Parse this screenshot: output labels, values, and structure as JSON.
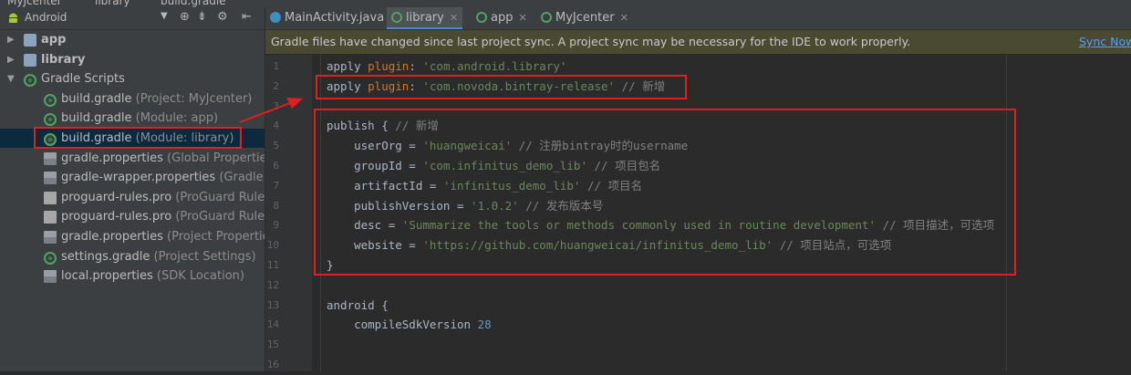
{
  "topbar": {
    "crumbs": [
      "MyJcenter",
      "library",
      "build.gradle"
    ]
  },
  "project_panel": {
    "view_label": "Android",
    "tree": [
      {
        "label": "app",
        "sub": "",
        "kind": "module",
        "arrow": "▶"
      },
      {
        "label": "library",
        "sub": "",
        "kind": "module",
        "arrow": "▶"
      },
      {
        "label": "Gradle Scripts",
        "sub": "",
        "kind": "gradle",
        "arrow": "▼"
      },
      {
        "label": "build.gradle",
        "sub": "(Project: MyJcenter)",
        "kind": "gradle"
      },
      {
        "label": "build.gradle",
        "sub": "(Module: app)",
        "kind": "gradle"
      },
      {
        "label": "build.gradle",
        "sub": "(Module: library)",
        "kind": "gradle",
        "selected": true
      },
      {
        "label": "gradle.properties",
        "sub": "(Global Properties)",
        "kind": "prop"
      },
      {
        "label": "gradle-wrapper.properties",
        "sub": "(Gradle Ve",
        "kind": "prop"
      },
      {
        "label": "proguard-rules.pro",
        "sub": "(ProGuard Rules fo",
        "kind": "pro"
      },
      {
        "label": "proguard-rules.pro",
        "sub": "(ProGuard Rules fo",
        "kind": "pro"
      },
      {
        "label": "gradle.properties",
        "sub": "(Project Properties)",
        "kind": "prop"
      },
      {
        "label": "settings.gradle",
        "sub": "(Project Settings)",
        "kind": "gradle"
      },
      {
        "label": "local.properties",
        "sub": "(SDK Location)",
        "kind": "prop"
      }
    ]
  },
  "tabs": [
    {
      "label": "MainActivity.java",
      "icon": "class-icon",
      "active": false
    },
    {
      "label": "library",
      "icon": "gradle-icon",
      "active": true
    },
    {
      "label": "app",
      "icon": "gradle-icon",
      "active": false
    },
    {
      "label": "MyJcenter",
      "icon": "gradle-icon",
      "active": false
    }
  ],
  "notification": {
    "message": "Gradle files have changed since last project sync. A project sync may be necessary for the IDE to work properly.",
    "action": "Sync Now"
  },
  "editor": {
    "lines": [
      {
        "n": "1",
        "parts": [
          [
            "plain",
            "apply "
          ],
          [
            "kw",
            "plugin"
          ],
          [
            "plain",
            ": "
          ],
          [
            "str",
            "'com.android.library'"
          ]
        ]
      },
      {
        "n": "2",
        "parts": [
          [
            "plain",
            "apply "
          ],
          [
            "kw",
            "plugin"
          ],
          [
            "plain",
            ": "
          ],
          [
            "str",
            "'com.novoda.bintray-release'"
          ],
          [
            "cm",
            " // 新增"
          ]
        ]
      },
      {
        "n": "3",
        "parts": []
      },
      {
        "n": "4",
        "parts": [
          [
            "plain",
            "publish { "
          ],
          [
            "cm",
            "// 新增"
          ]
        ],
        "fold": true
      },
      {
        "n": "5",
        "parts": [
          [
            "plain",
            "    userOrg = "
          ],
          [
            "str",
            "'huangweicai'"
          ],
          [
            "cm",
            " // 注册bintray时的username"
          ]
        ]
      },
      {
        "n": "6",
        "parts": [
          [
            "plain",
            "    groupId = "
          ],
          [
            "str",
            "'com.infinitus_demo_lib'"
          ],
          [
            "cm",
            " // 项目包名"
          ]
        ]
      },
      {
        "n": "7",
        "parts": [
          [
            "plain",
            "    artifactId = "
          ],
          [
            "str",
            "'infinitus_demo_lib'"
          ],
          [
            "cm",
            " // 项目名"
          ]
        ]
      },
      {
        "n": "8",
        "parts": [
          [
            "plain",
            "    publishVersion = "
          ],
          [
            "str",
            "'1.0.2'"
          ],
          [
            "cm",
            " // 发布版本号"
          ]
        ]
      },
      {
        "n": "9",
        "parts": [
          [
            "plain",
            "    desc = "
          ],
          [
            "str",
            "'Summarize the tools or methods commonly used in routine development'"
          ],
          [
            "cm",
            " // 项目描述，可选项"
          ]
        ]
      },
      {
        "n": "10",
        "parts": [
          [
            "plain",
            "    website = "
          ],
          [
            "str",
            "'https://github.com/huangweicai/infinitus_demo_lib'"
          ],
          [
            "cm",
            " // 项目站点，可选项"
          ]
        ]
      },
      {
        "n": "11",
        "parts": [
          [
            "plain",
            "}"
          ]
        ],
        "fold": true
      },
      {
        "n": "12",
        "parts": []
      },
      {
        "n": "13",
        "parts": [
          [
            "plain",
            "android {"
          ]
        ],
        "fold": true
      },
      {
        "n": "14",
        "parts": [
          [
            "plain",
            "    compileSdkVersion "
          ],
          [
            "num",
            "28"
          ]
        ]
      },
      {
        "n": "15",
        "parts": []
      },
      {
        "n": "16",
        "parts": []
      }
    ]
  },
  "colors": {
    "annotation_red": "#e02020",
    "selection": "#0d293e",
    "string": "#6a8759",
    "comment": "#808080",
    "keyword": "#cc7832"
  }
}
